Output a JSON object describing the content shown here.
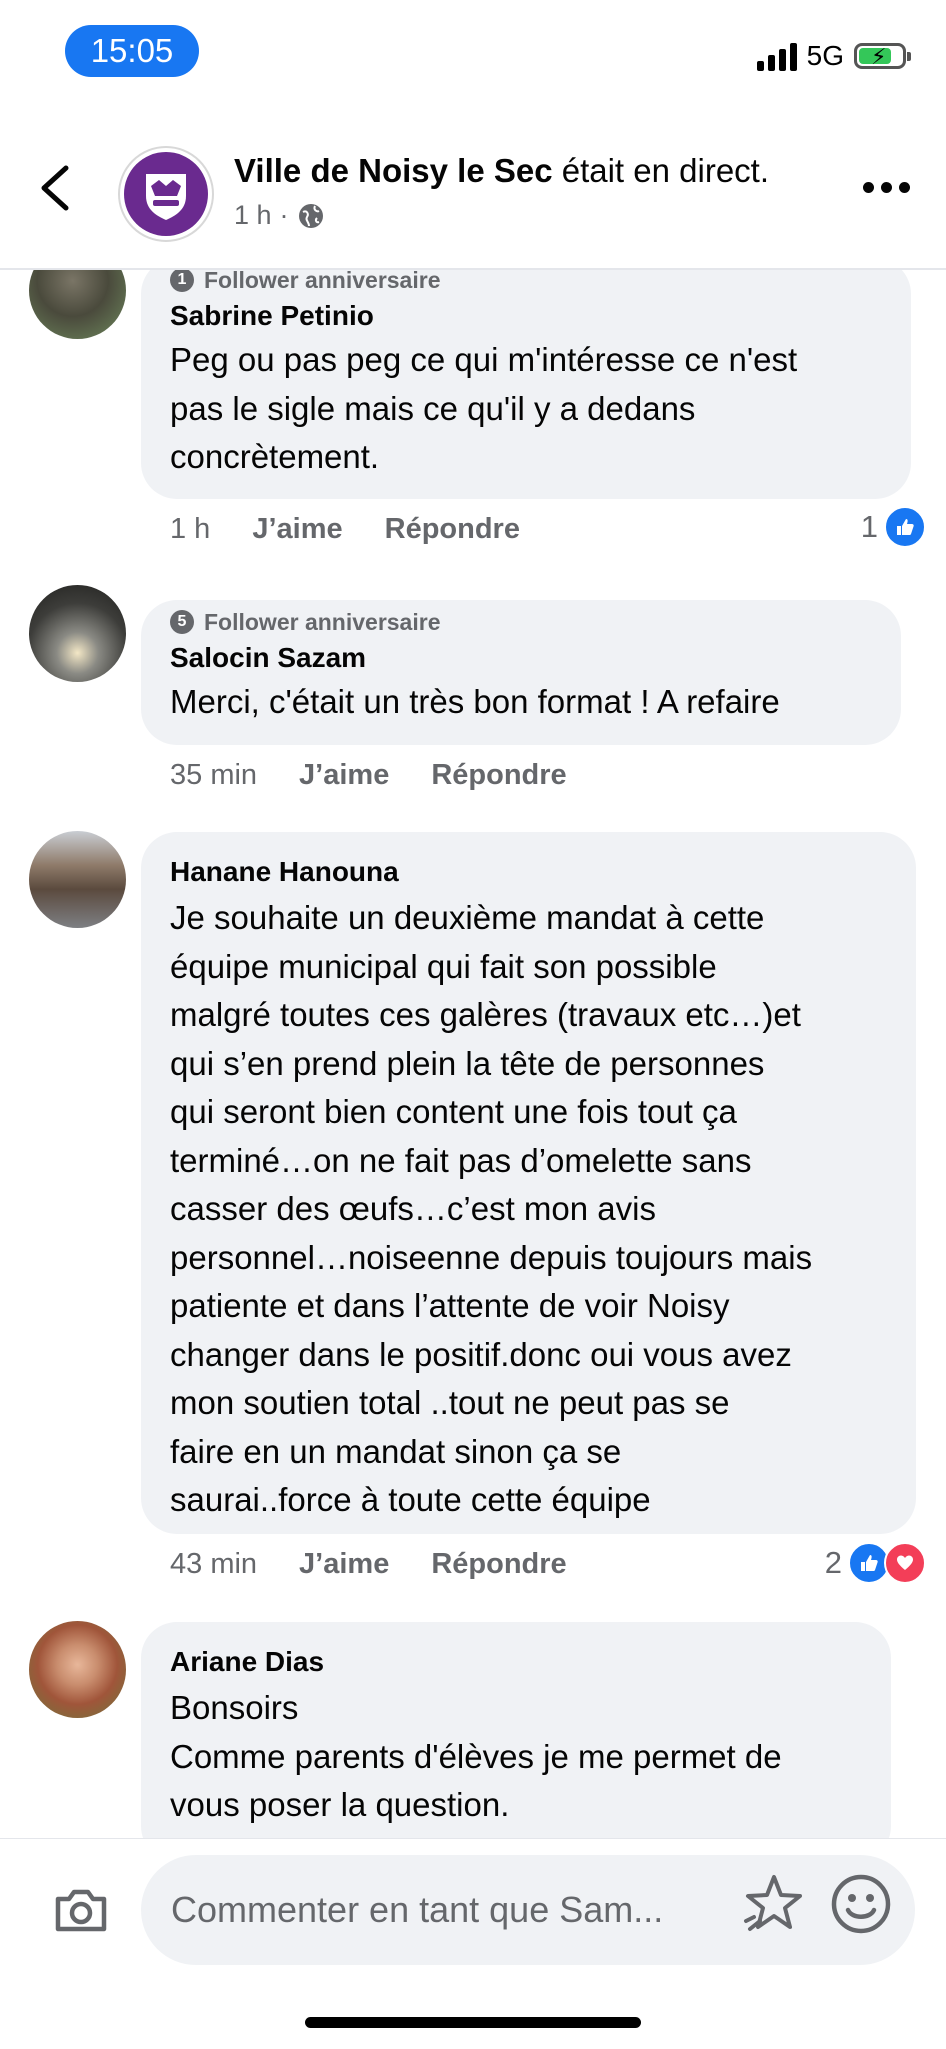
{
  "status_bar": {
    "time": "15:05",
    "network": "5G"
  },
  "header": {
    "page_name": "Ville de Noisy le Sec",
    "suffix": " était en direct.",
    "time_ago": "1 h",
    "dot": "·"
  },
  "comments": [
    {
      "badge": "Follower anniversaire",
      "badge_number": "1",
      "author": "Sabrine Petinio",
      "text": "Peg ou pas peg ce qui m'intéresse ce n'est\npas le sigle mais ce qu'il y a dedans\nconcrètement.",
      "time": "1 h",
      "like_label": "J’aime",
      "reply_label": "Répondre",
      "reaction_count": "1"
    },
    {
      "badge": "Follower anniversaire",
      "badge_number": "5",
      "author": "Salocin Sazam",
      "text": "Merci, c'était un très bon format ! A refaire",
      "time": "35 min",
      "like_label": "J’aime",
      "reply_label": "Répondre"
    },
    {
      "author": "Hanane Hanouna",
      "text": "Je souhaite un deuxième mandat à cette\néquipe municipal qui fait son possible\nmalgré toutes ces galères (travaux etc…)et\nqui s’en prend plein la tête de personnes\nqui seront bien content une fois tout ça\nterminé…on ne fait pas d’omelette sans\ncasser des œufs…c’est mon avis\npersonnel…noiseenne depuis toujours mais\npatiente et dans l’attente de voir Noisy\nchanger dans le positif.donc oui vous avez\nmon soutien total ..tout ne peut pas se\nfaire en un mandat sinon ça se\nsaurai..force à toute cette équipe",
      "time": "43 min",
      "like_label": "J’aime",
      "reply_label": "Répondre",
      "reaction_count": "2"
    },
    {
      "author": "Ariane Dias",
      "text": "Bonsoirs\nComme parents d'élèves je me permet de\nvous poser la question."
    }
  ],
  "composer": {
    "placeholder": "Commenter en tant que Sam..."
  },
  "colors": {
    "accent": "#1877f2",
    "bubble": "#f0f2f5",
    "love": "#f33e58",
    "page_purple": "#6a2a8f"
  }
}
